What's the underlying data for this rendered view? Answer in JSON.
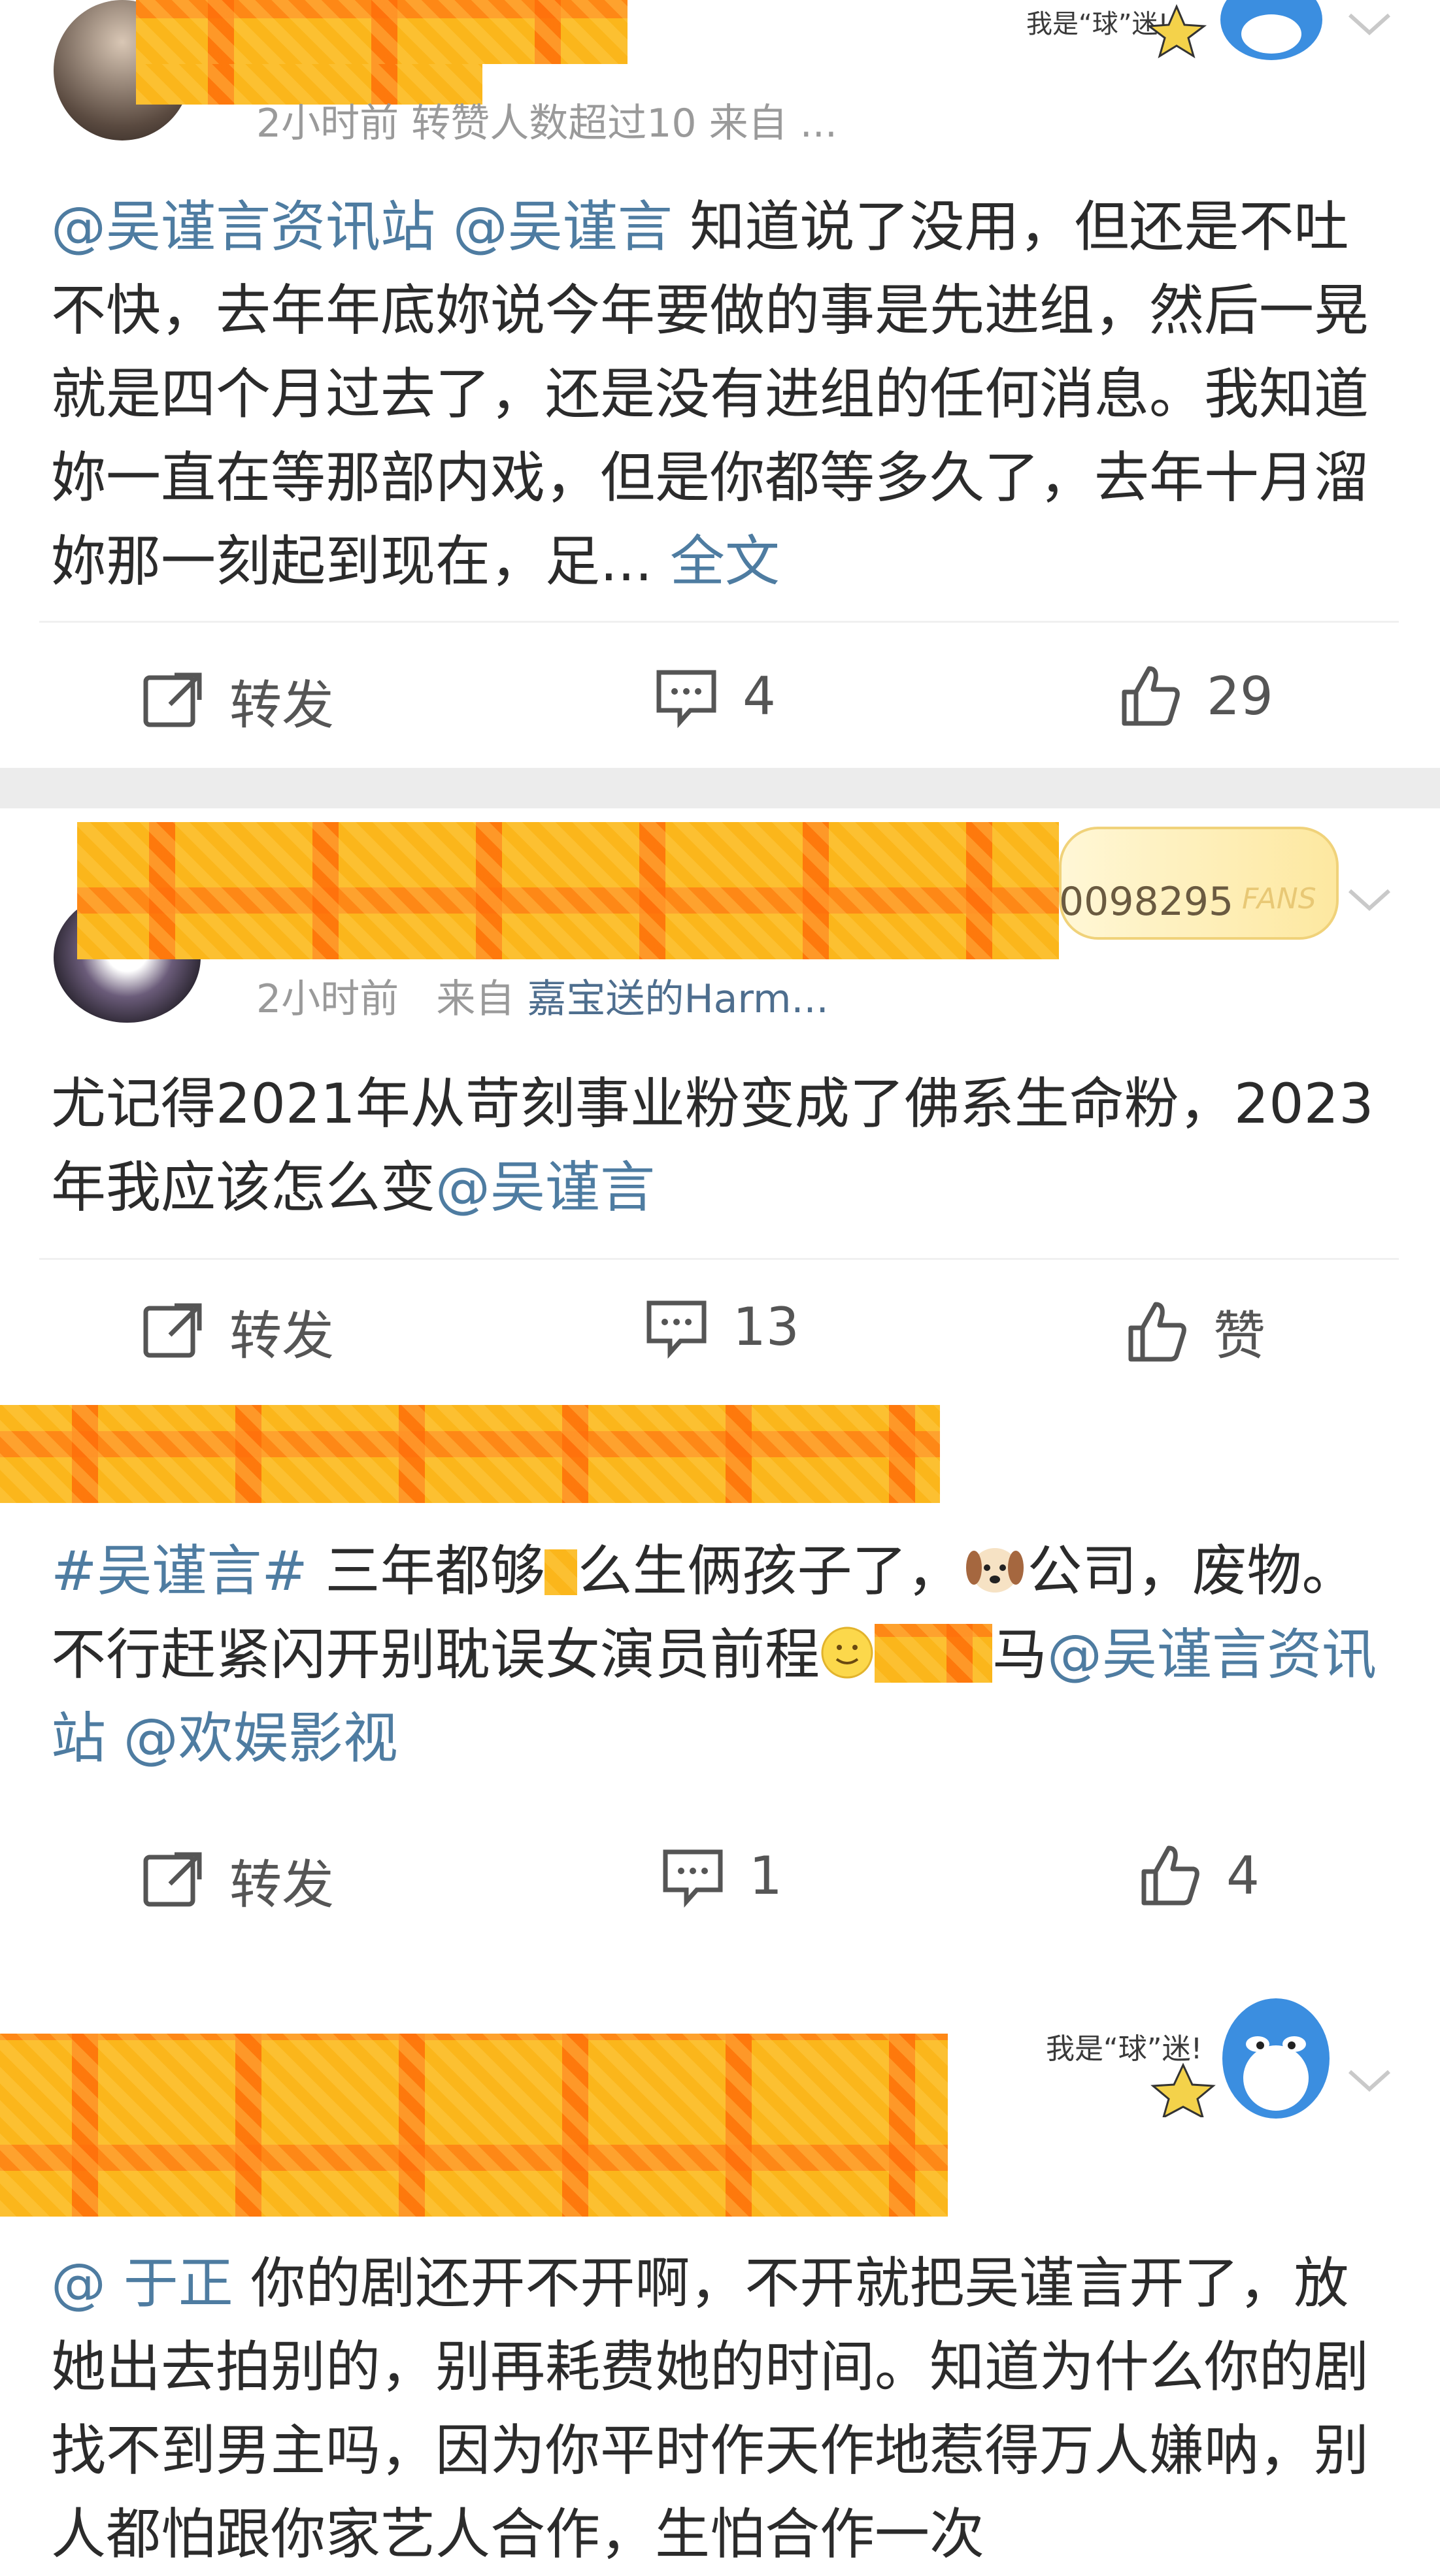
{
  "posts": [
    {
      "meta": "2小时前 转赞人数超过10 来自 ...",
      "text_segments": [
        {
          "t": "@吴谨言资讯站",
          "mention": true
        },
        {
          "t": " ",
          "mention": false
        },
        {
          "t": "@吴谨言",
          "mention": true
        },
        {
          "t": " 知道说了没用，但还是不吐不快，去年年底妳说今年要做的事是先进组，然后一晃就是四个月过去了，还是没有进组的任何消息。我知道妳一直在等那部内戏，但是你都等多久了，去年十月溜妳那一刻起到现在，足... ",
          "mention": false
        },
        {
          "t": "全文",
          "mention": true
        }
      ],
      "actions": {
        "repost": "转发",
        "comments": "4",
        "likes": "29"
      },
      "badge_text": "我是“球”迷!"
    },
    {
      "fans_id": "0098295",
      "fans_label": "FANS",
      "meta_time": "2小时前",
      "meta_from": "来自",
      "meta_source": "嘉宝送的Harm...",
      "text_segments": [
        {
          "t": "尤记得2021年从苛刻事业粉变成了佛系生命粉，2023年我应该怎么变",
          "mention": false
        },
        {
          "t": "@吴谨言",
          "mention": true
        }
      ],
      "actions": {
        "repost": "转发",
        "comments": "13",
        "likes": "赞"
      }
    },
    {
      "text_segments": [
        {
          "t": "#吴谨言#",
          "mention": true
        },
        {
          "t": " 三年都够",
          "mention": false
        },
        {
          "t": "么生俩孩子了，",
          "mention": false
        },
        {
          "t": "公司，废物。不行赶紧闪开别耽误女演员前程",
          "mention": false
        },
        {
          "t": "马",
          "mention": false
        },
        {
          "t": "@吴谨言资讯站",
          "mention": true
        },
        {
          "t": " ",
          "mention": false
        },
        {
          "t": "@欢娱影视",
          "mention": true
        }
      ],
      "actions": {
        "repost": "转发",
        "comments": "1",
        "likes": "4"
      }
    },
    {
      "badge_text": "我是“球”迷!",
      "text_segments": [
        {
          "t": "@ 于正",
          "mention": true
        },
        {
          "t": " 你的剧还开不开啊，不开就把吴谨言开了，放她出去拍别的，别再耗费她的时间。知道为什么你的剧找不到男主吗，因为你平时作天作地惹得万人嫌呐，别人都怕跟你家艺人合作，生怕合作一次",
          "mention": false
        }
      ]
    }
  ],
  "icons": {
    "repost": "repost-icon",
    "comment": "comment-icon",
    "like": "thumbs-up-icon",
    "chevron": "chevron-down-icon",
    "dog": "dog-emoji-icon",
    "smile": "smile-emoji-icon"
  },
  "colors": {
    "mention": "#4e7ca1",
    "text": "#2b2b2b",
    "meta": "#9a9a9a",
    "separator": "#ececec",
    "redaction": "#fbb61b"
  }
}
